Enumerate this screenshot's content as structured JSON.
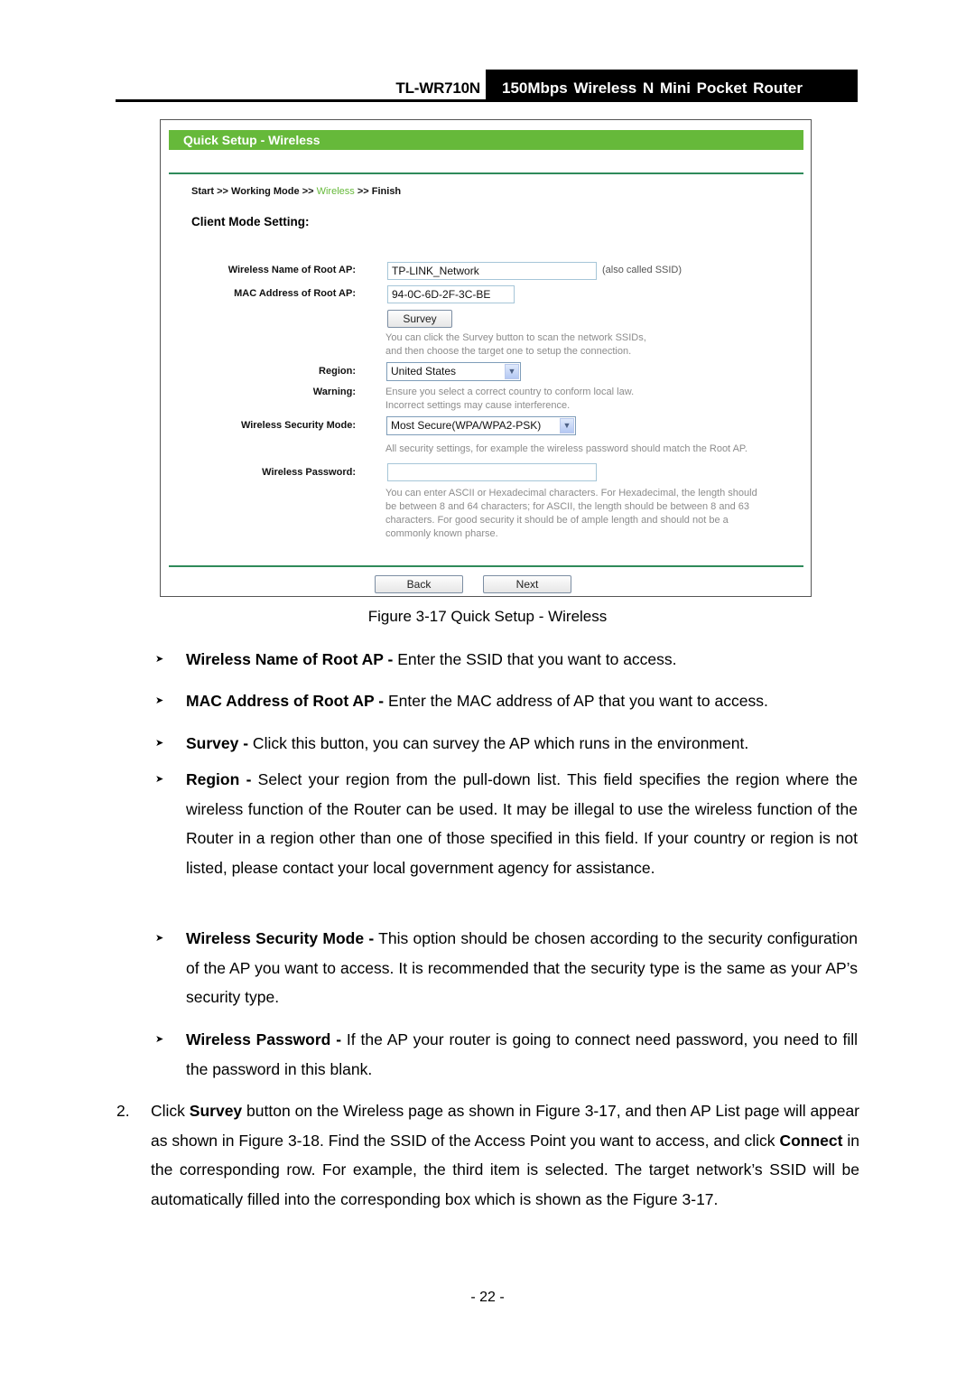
{
  "header": {
    "model": "TL-WR710N",
    "product": "150Mbps Wireless N Mini Pocket Router"
  },
  "figure": {
    "banner": "Quick Setup - Wireless",
    "breadcrumb": {
      "steps": [
        "Start",
        "Working Mode",
        "Wireless",
        "Finish"
      ],
      "separator": ">>",
      "current": "Wireless"
    },
    "section_title": "Client Mode Setting:",
    "fields": {
      "ssid": {
        "label": "Wireless Name of Root AP:",
        "value": "TP-LINK_Network",
        "hint": "(also called SSID)"
      },
      "mac": {
        "label": "MAC Address of Root AP:",
        "value": "94-0C-6D-2F-3C-BE"
      },
      "survey": {
        "button": "Survey",
        "note_lines": [
          "You can click the Survey button to scan the network SSIDs,",
          "and then choose the target one to setup the connection."
        ]
      },
      "region": {
        "label": "Region:",
        "value": "United States"
      },
      "warning": {
        "label": "Warning:",
        "note_lines": [
          "Ensure you select a correct country to conform local law.",
          "Incorrect settings may cause interference."
        ]
      },
      "security": {
        "label": "Wireless Security Mode:",
        "value": "Most Secure(WPA/WPA2-PSK)",
        "note": "All security settings, for example the wireless password should match the Root AP."
      },
      "password": {
        "label": "Wireless Password:",
        "value": "",
        "note_lines": [
          "You can enter ASCII or Hexadecimal characters. For Hexadecimal, the length should",
          "be between 8 and 64 characters; for ASCII, the length should be between 8 and 63",
          "characters. For good security it should be of ample length and should not be a",
          "commonly known pharse."
        ]
      }
    },
    "buttons": {
      "back": "Back",
      "next": "Next"
    },
    "caption": "Figure 3-17 Quick Setup - Wireless"
  },
  "bullets": [
    {
      "term": "Wireless Name of Root AP -",
      "text": " Enter the SSID that you want to access."
    },
    {
      "term": "MAC Address of Root AP -",
      "text": " Enter the MAC address of AP that you want to access."
    },
    {
      "term": "Survey -",
      "text": " Click this button, you can survey the AP which runs in the environment."
    },
    {
      "term": "Region -",
      "text": " Select your region from the pull-down list. This field specifies the region where the wireless function of the Router can be used. It may be illegal to use the wireless function of the Router in a region other than one of those specified in this field. If your country or region is not listed, please contact your local government agency for assistance."
    },
    {
      "term": "Wireless Security Mode -",
      "text": " This option should be chosen according to the security configuration of the AP you want to access. It is recommended that the security type is the same as your AP’s security type."
    },
    {
      "term": "Wireless Password -",
      "text": " If the AP your router is going to connect need password, you need to fill the password in this blank."
    }
  ],
  "step2": {
    "number": "2.",
    "parts": [
      "Click ",
      "Survey",
      " button on the Wireless page as shown in Figure 3-17, and then AP List page will appear as shown in Figure 3-18. Find the SSID of the Access Point you want to access, and click ",
      "Connect",
      " in the corresponding row. For example, the third item is selected. The target network’s SSID will be automatically filled into the corresponding box which is shown as the Figure 3-17."
    ]
  },
  "page_number": "- 22 -",
  "colors": {
    "banner_green": "#66b93a",
    "rule_green": "#2f8a5a",
    "note_gray": "#8c8c8c"
  }
}
